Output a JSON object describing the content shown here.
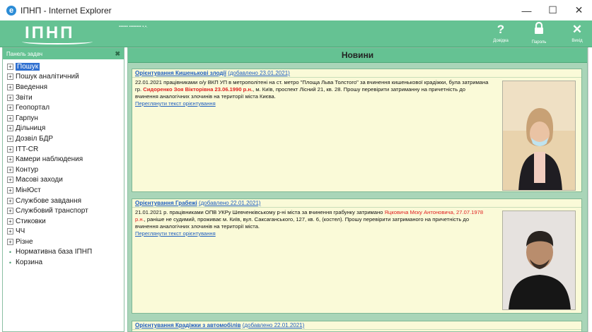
{
  "window": {
    "title": "ІПНП - Internet Explorer",
    "minimize": "—",
    "maximize": "☐",
    "close": "✕"
  },
  "header": {
    "logo": "ІПНП",
    "user_info": "▪▪▪▪▪▪ ▪▪▪▪▪▪▪▪ ▪.▪.",
    "help": {
      "glyph": "?",
      "label": "Довідка"
    },
    "password": {
      "glyph": "🔒",
      "label": "Пароль"
    },
    "exit": {
      "glyph": "✕",
      "label": "Вихід"
    }
  },
  "sidebar": {
    "title": "Панель задач",
    "close": "✖",
    "items": [
      {
        "label": "Пошук",
        "type": "plus",
        "selected": true
      },
      {
        "label": "Пошук аналітичний",
        "type": "plus"
      },
      {
        "label": "Введення",
        "type": "plus"
      },
      {
        "label": "Звіти",
        "type": "plus"
      },
      {
        "label": "Геопортал",
        "type": "plus"
      },
      {
        "label": "Гарпун",
        "type": "plus"
      },
      {
        "label": "Дільниця",
        "type": "plus"
      },
      {
        "label": "Дозвіл БДР",
        "type": "plus"
      },
      {
        "label": "ITT-CR",
        "type": "plus"
      },
      {
        "label": "Камери наблюдения",
        "type": "plus"
      },
      {
        "label": "Контур",
        "type": "plus"
      },
      {
        "label": "Масові заходи",
        "type": "plus"
      },
      {
        "label": "МінЮст",
        "type": "plus"
      },
      {
        "label": "Службове завдання",
        "type": "plus"
      },
      {
        "label": "Службовий транспорт",
        "type": "plus"
      },
      {
        "label": "Стиковки",
        "type": "plus"
      },
      {
        "label": "ЧЧ",
        "type": "plus"
      },
      {
        "label": "Різне",
        "type": "plus"
      },
      {
        "label": "Нормативна база ІПНП",
        "type": "bullet"
      },
      {
        "label": "Корзина",
        "type": "bullet"
      }
    ]
  },
  "main": {
    "title": "Новини",
    "news": [
      {
        "title": "Орієнтування Кишенькові злодії",
        "date": "(добавлено 23.01.2021)",
        "text_before": "22.01.2021 працівниками о/у ВКП УП в метрополітені на ст. метро \"Площа Льва Толстого\" за вчинення кишенькової крадіжки, була затримана гр. ",
        "highlight": "Сидоренко Зоя Вікторівна 23.06.1990 р.н.",
        "text_after": ", м. Київ, проспект Лісний 21, кв. 28. Прошу перевірити затриманну на причетність до вчинення аналогічних злочинів на території міста Києва.",
        "more": "Переглянути текст орієнтування"
      },
      {
        "title": "Орієнтування Грабежі",
        "date": "(добавлено 22.01.2021)",
        "text_before": "21.01.2021 р. працівниками ОПВ УКРу Шевченківському р-ні міста за вчинення грабунку затримано ",
        "highlight": "Яцковича Мєку Антоновича, 27.07.1978 р.н.",
        "text_after": ", раніше не судимий, проживає м. Київ, вул. Саксаганського, 127, кв. 6, (костел). Прошу перевірити затриманого на причетність до вчинення аналогічних злочинів на території міста.",
        "more": "Переглянути текст орієнтування"
      },
      {
        "title": "Орієнтування Крадіжки з автомобілів",
        "date": "(добавлено 22.01.2021)"
      }
    ]
  },
  "colors": {
    "accent": "#65c293",
    "panel_bg": "#a9d5b8",
    "card_bg": "#fafad8",
    "link": "#1f5fc0",
    "highlight": "#e02020"
  }
}
